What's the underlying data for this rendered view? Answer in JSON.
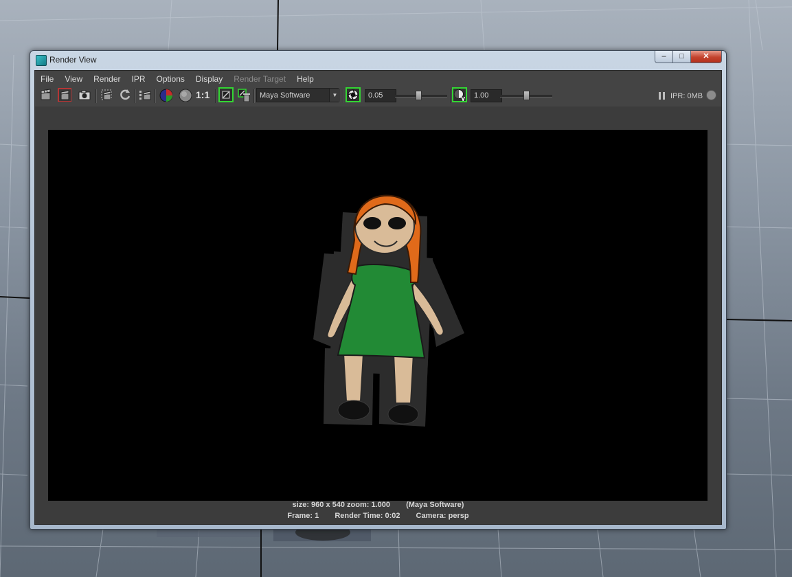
{
  "window": {
    "title": "Render View",
    "controls": {
      "minimize": "–",
      "maximize": "□",
      "close": "✕"
    }
  },
  "menu": [
    "File",
    "View",
    "Render",
    "IPR",
    "Options",
    "Display",
    "Render Target",
    "Help"
  ],
  "menu_disabled": [
    "Render Target"
  ],
  "toolbar": {
    "ratio_label": "1:1",
    "renderer": "Maya Software",
    "exposure": "0.05",
    "exposure_level": 0.45,
    "gamma": "1.00",
    "gamma_level": 0.5,
    "ipr_status": "IPR: 0MB",
    "icons": [
      "render-frame-icon",
      "redo-render-icon",
      "snapshot-icon",
      "render-region-icon",
      "refresh-icon",
      "render-sequence-icon",
      "color-channels-icon",
      "alpha-channel-icon",
      "keep-image-icon",
      "remove-image-icon",
      "exposure-icon",
      "gamma-icon",
      "pause-icon",
      "ipr-dot-icon"
    ]
  },
  "status": {
    "size_zoom": "size: 960 x 540 zoom: 1.000",
    "renderer": "(Maya Software)",
    "frame": "Frame: 1",
    "render_time": "Render Time: 0:02",
    "camera": "Camera: persp"
  },
  "colors": {
    "hair": "#e06a1a",
    "skin": "#d9bb98",
    "dress": "#228a35",
    "accent_green": "#33d633"
  }
}
